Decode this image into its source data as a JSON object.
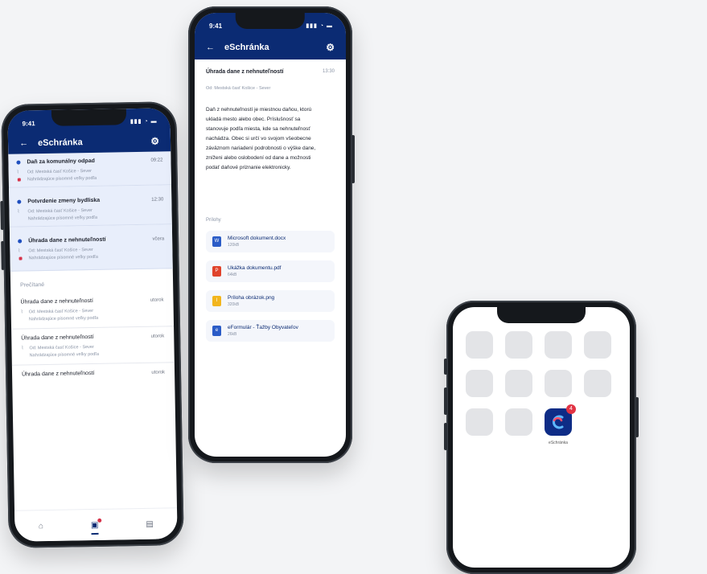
{
  "accent_color": "#0b2b73",
  "phone_list": {
    "status_time": "9:41",
    "title": "eSchránka",
    "unread": [
      {
        "subject": "Daň za komunálny odpad",
        "time": "09:22",
        "sender": "Od: Mestská časť Košice - Sever",
        "flag": "Nahrádzajúce písomné veľky podľa"
      },
      {
        "subject": "Potvrdenie zmeny bydliska",
        "time": "12:30",
        "sender": "Od: Mestská časť Košice - Sever",
        "flag": "Nahrádzajúce písomné veľky podľa"
      },
      {
        "subject": "Úhrada dane z nehnuteľností",
        "time": "včera",
        "sender": "Od: Mestská časť Košice - Sever",
        "flag": "Nahrádzajúce písomné veľky podľa"
      }
    ],
    "read_section": "Prečítané",
    "read": [
      {
        "subject": "Úhrada dane z nehnuteľností",
        "time": "utorok",
        "sender": "Od: Mestská časť Košice - Sever",
        "flag": "Nahrádzajúce písomné veľky podľa"
      },
      {
        "subject": "Úhrada dane z nehnuteľností",
        "time": "utorok",
        "sender": "Od: Mestská časť Košice - Sever",
        "flag": "Nahrádzajúce písomné veľky podľa"
      },
      {
        "subject": "Úhrada dane z nehnuteľností",
        "time": "utorok",
        "sender": "",
        "flag": ""
      }
    ],
    "tabs": [
      "home-icon",
      "mailbox-icon",
      "documents-icon"
    ]
  },
  "phone_detail": {
    "status_time": "9:41",
    "title": "eSchránka",
    "subject": "Úhrada dane z nehnuteľností",
    "time": "13:30",
    "sender": "Od: Mestská časť Košice - Sever",
    "body": "Daň z nehnuteľností je miestnou daňou, ktorú ukladá mesto alebo obec. Príslušnosť sa stanovuje podľa miesta, kde sa nehnuteľnosť nachádza. Obec si určí vo svojom všeobecne záväznom nariadení podrobnosti o výške dane, zníženi alebo oslobodení od dane a možnosti podať daňové priznanie elektronicky.",
    "attachments_label": "Prílohy",
    "attachments": [
      {
        "name": "Microsoft dokument.docx",
        "size": "120kB",
        "color": "#2b5cc7",
        "icon": "W"
      },
      {
        "name": "Ukážka dokumentu.pdf",
        "size": "64kB",
        "color": "#e0432b",
        "icon": "P"
      },
      {
        "name": "Príloha obrázok.png",
        "size": "320kB",
        "color": "#f2b51d",
        "icon": "I"
      },
      {
        "name": "eFormulár - Ťažby Obyvateľov",
        "size": "26kB",
        "color": "#2b5cc7",
        "icon": "e"
      }
    ]
  },
  "phone_home": {
    "app_label": "eSchránka",
    "badge_count": "4"
  }
}
